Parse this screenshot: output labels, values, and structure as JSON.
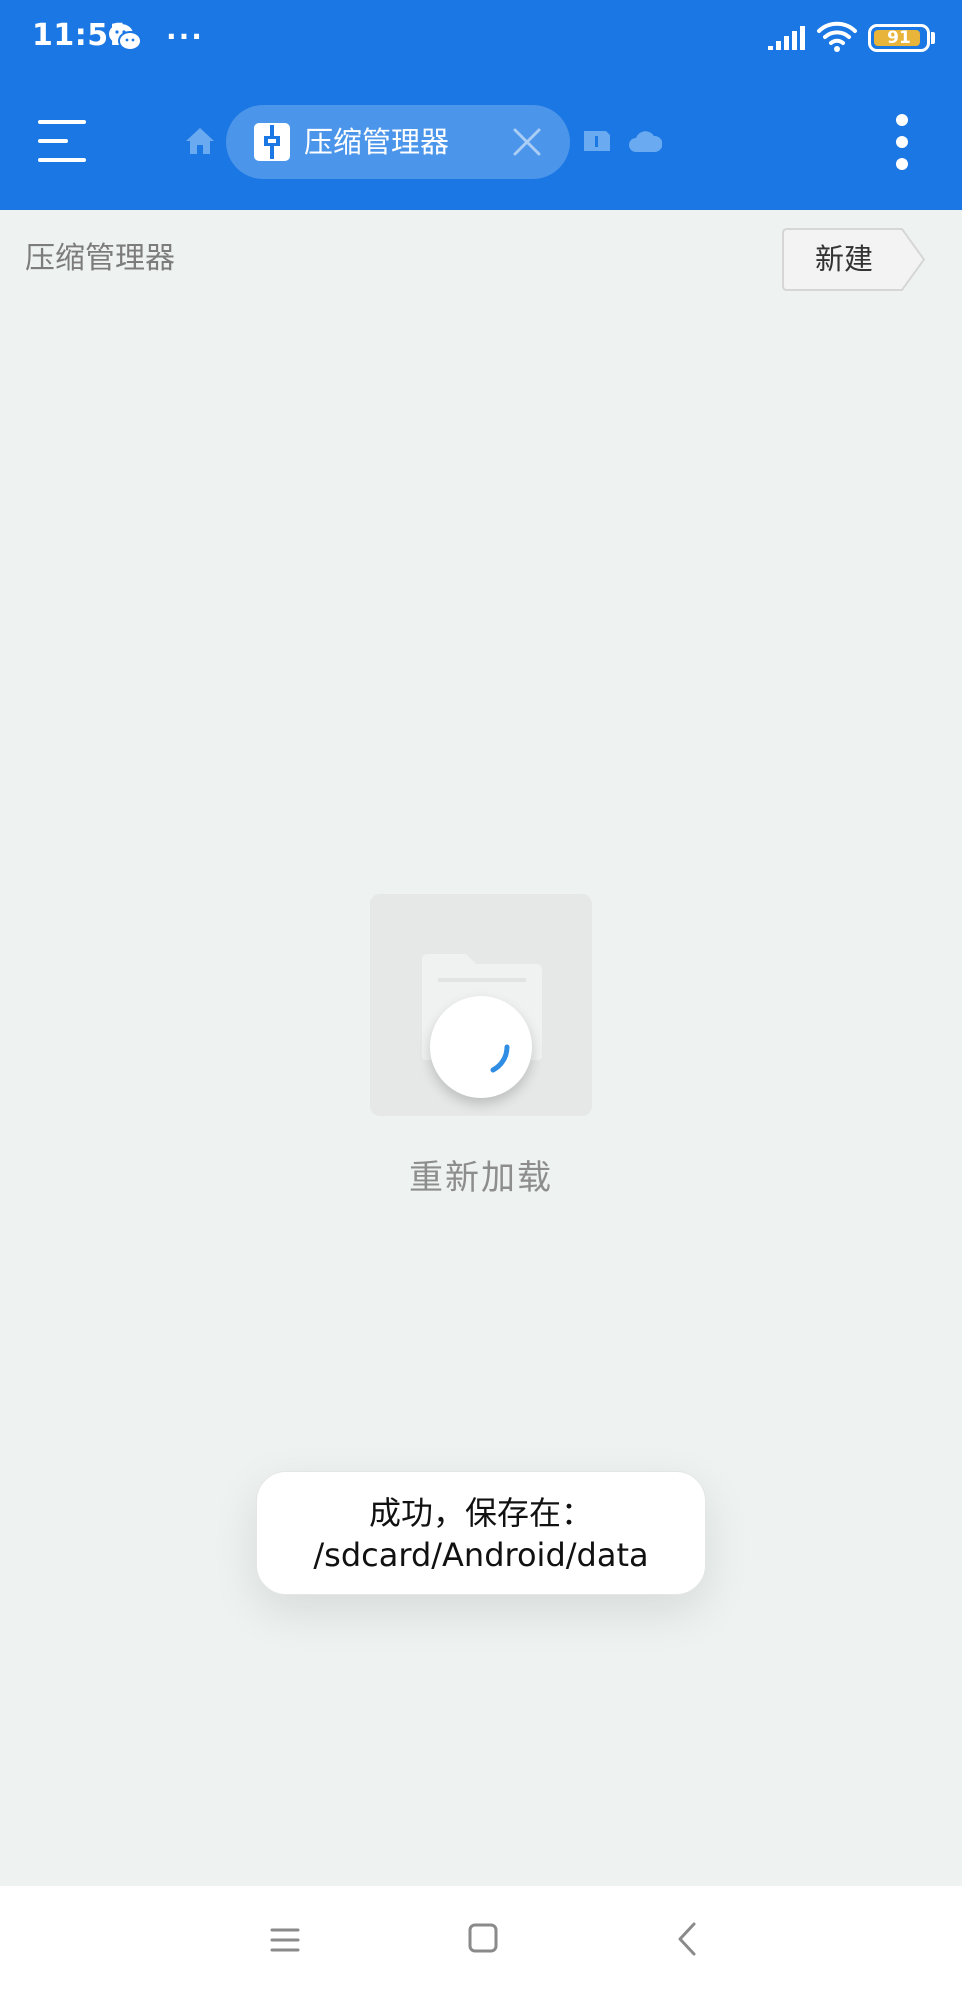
{
  "status_bar": {
    "time": "11:51",
    "more": "···",
    "battery_level": "91",
    "battery_fraction": 0.91,
    "icons": [
      "wechat-icon",
      "signal-icon",
      "wifi-icon",
      "battery-icon"
    ]
  },
  "app_bar": {
    "tab_label": "压缩管理器",
    "icons": [
      "menu-icon",
      "home-icon",
      "archive-app-icon",
      "close-icon",
      "card-icon",
      "cloud-icon",
      "overflow-menu-icon"
    ]
  },
  "path_bar": {
    "breadcrumb": "压缩管理器",
    "new_button": "新建"
  },
  "content": {
    "reload_label": "重新加载"
  },
  "toast": {
    "line1": "成功，保存在：",
    "line2": "/sdcard/Android/data"
  },
  "nav_bar": {
    "icons": [
      "recents-menu-icon",
      "home-square-icon",
      "back-chevron-icon"
    ]
  },
  "colors": {
    "primary": "#1b77e3",
    "tab_pill": "#4b95ea",
    "background": "#eef3f2",
    "battery": "#e8b43a",
    "spinner": "#2f8de4"
  }
}
